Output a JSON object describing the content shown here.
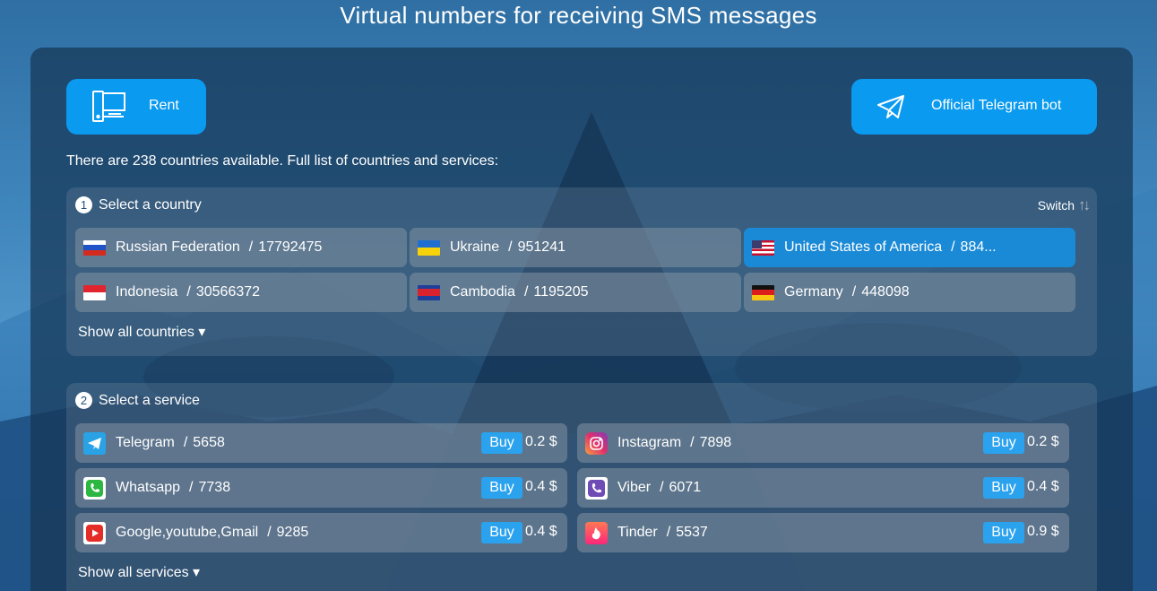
{
  "page_title": "Virtual numbers for receiving SMS messages",
  "buttons": {
    "rent_label": "Rent",
    "telegram_bot_label": "Official Telegram bot"
  },
  "available_text": "There are 238 countries available. Full list of countries and services:",
  "country_section": {
    "step": "1",
    "title": "Select a country",
    "switch_label": "Switch",
    "switch_icon": "sort-arrows-icon",
    "show_all": "Show all countries ▾",
    "countries": [
      {
        "name": "Russian Federation",
        "count": "17792475",
        "flag": "russia-flag-icon",
        "selected": false
      },
      {
        "name": "Ukraine",
        "count": "951241",
        "flag": "ukraine-flag-icon",
        "selected": false
      },
      {
        "name": "United States of America",
        "count": "884...",
        "flag": "usa-flag-icon",
        "selected": true
      },
      {
        "name": "Indonesia",
        "count": "30566372",
        "flag": "indonesia-flag-icon",
        "selected": false
      },
      {
        "name": "Cambodia",
        "count": "1195205",
        "flag": "cambodia-flag-icon",
        "selected": false
      },
      {
        "name": "Germany",
        "count": "448098",
        "flag": "germany-flag-icon",
        "selected": false
      }
    ]
  },
  "service_section": {
    "step": "2",
    "title": "Select a service",
    "buy_label": "Buy",
    "show_all": "Show all services ▾",
    "services": [
      {
        "name": "Telegram",
        "count": "5658",
        "price": "0.2",
        "currency": "$",
        "icon": "telegram-icon"
      },
      {
        "name": "Instagram",
        "count": "7898",
        "price": "0.2",
        "currency": "$",
        "icon": "instagram-icon"
      },
      {
        "name": "Whatsapp",
        "count": "7738",
        "price": "0.4",
        "currency": "$",
        "icon": "whatsapp-icon"
      },
      {
        "name": "Viber",
        "count": "6071",
        "price": "0.4",
        "currency": "$",
        "icon": "viber-icon"
      },
      {
        "name": "Google,youtube,Gmail",
        "count": "9285",
        "price": "0.4",
        "currency": "$",
        "icon": "youtube-icon"
      },
      {
        "name": "Tinder",
        "count": "5537",
        "price": "0.9",
        "currency": "$",
        "icon": "tinder-icon"
      }
    ]
  },
  "colors": {
    "accent": "#0a9aef",
    "selected_item": "#1b8ad6",
    "buy_button": "#2aa2ee"
  }
}
